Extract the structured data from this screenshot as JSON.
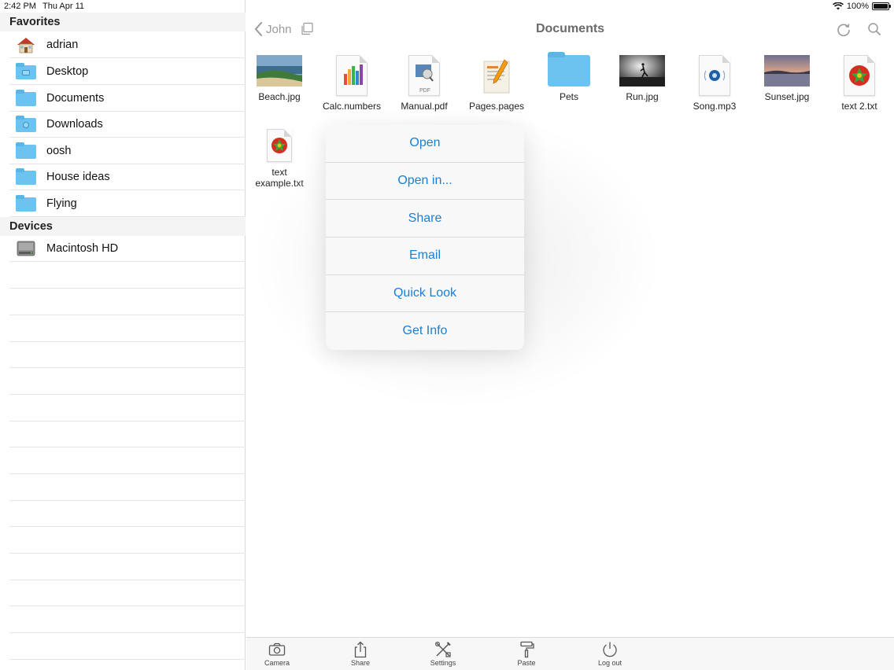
{
  "status_bar": {
    "time": "2:42 PM",
    "date": "Thu Apr 11",
    "battery": "100%"
  },
  "sidebar": {
    "favorites_header": "Favorites",
    "favorites": [
      {
        "label": "adrian",
        "icon": "home-icon"
      },
      {
        "label": "Desktop",
        "icon": "folder-icon"
      },
      {
        "label": "Documents",
        "icon": "folder-icon"
      },
      {
        "label": "Downloads",
        "icon": "folder-icon"
      },
      {
        "label": "oosh",
        "icon": "folder-icon"
      },
      {
        "label": "House ideas",
        "icon": "folder-icon"
      },
      {
        "label": "Flying",
        "icon": "folder-icon"
      }
    ],
    "devices_header": "Devices",
    "devices": [
      {
        "label": "Macintosh HD",
        "icon": "hard-drive-icon"
      }
    ]
  },
  "nav": {
    "back_label": "John",
    "title": "Documents"
  },
  "files": [
    {
      "name": "Beach.jpg"
    },
    {
      "name": "Calc.numbers"
    },
    {
      "name": "Manual.pdf",
      "badge": "PDF"
    },
    {
      "name": "Pages.pages"
    },
    {
      "name": "Pets"
    },
    {
      "name": "Run.jpg"
    },
    {
      "name": "Song.mp3"
    },
    {
      "name": "Sunset.jpg"
    },
    {
      "name": "text 2.txt"
    },
    {
      "name_line1": "text",
      "name_line2": "example.txt"
    }
  ],
  "context_menu": {
    "items": [
      "Open",
      "Open in...",
      "Share",
      "Email",
      "Quick Look",
      "Get Info"
    ]
  },
  "toolbar": {
    "items": [
      "Camera",
      "Share",
      "Settings",
      "Paste",
      "Log out"
    ]
  },
  "colors": {
    "accent": "#1a80d4",
    "folder": "#6cc3ef"
  }
}
